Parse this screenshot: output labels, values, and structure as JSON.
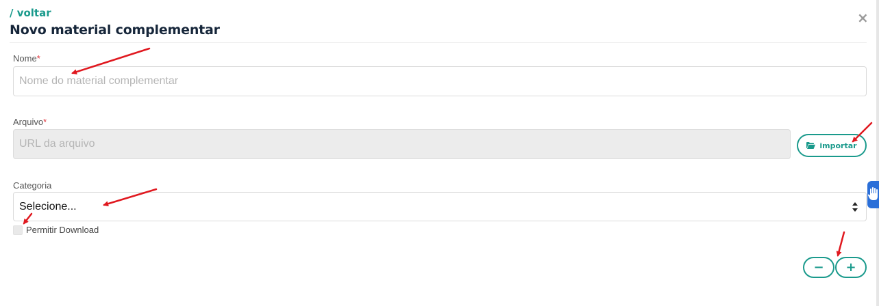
{
  "header": {
    "back_label": "/ voltar",
    "title": "Novo material complementar",
    "close_glyph": "×"
  },
  "form": {
    "nome": {
      "label": "Nome",
      "required_mark": "*",
      "placeholder": "Nome do material complementar",
      "value": ""
    },
    "arquivo": {
      "label": "Arquivo",
      "required_mark": "*",
      "placeholder": "URL da arquivo",
      "value": "",
      "import_label": "importar"
    },
    "categoria": {
      "label": "Categoria",
      "selected": "Selecione..."
    },
    "permitir_download": {
      "label": "Permitir Download",
      "checked": false
    }
  },
  "actions": {
    "minus_label": "−",
    "plus_label": "+"
  },
  "colors": {
    "accent": "#1a9a8c",
    "title": "#16263a",
    "required": "#e0323a",
    "annotation_arrow": "#e0181f",
    "accessibility_widget": "#2b6fd8"
  },
  "icons": [
    "close-icon",
    "folder-open-icon",
    "select-arrows-icon",
    "accessibility-hand-icon"
  ]
}
